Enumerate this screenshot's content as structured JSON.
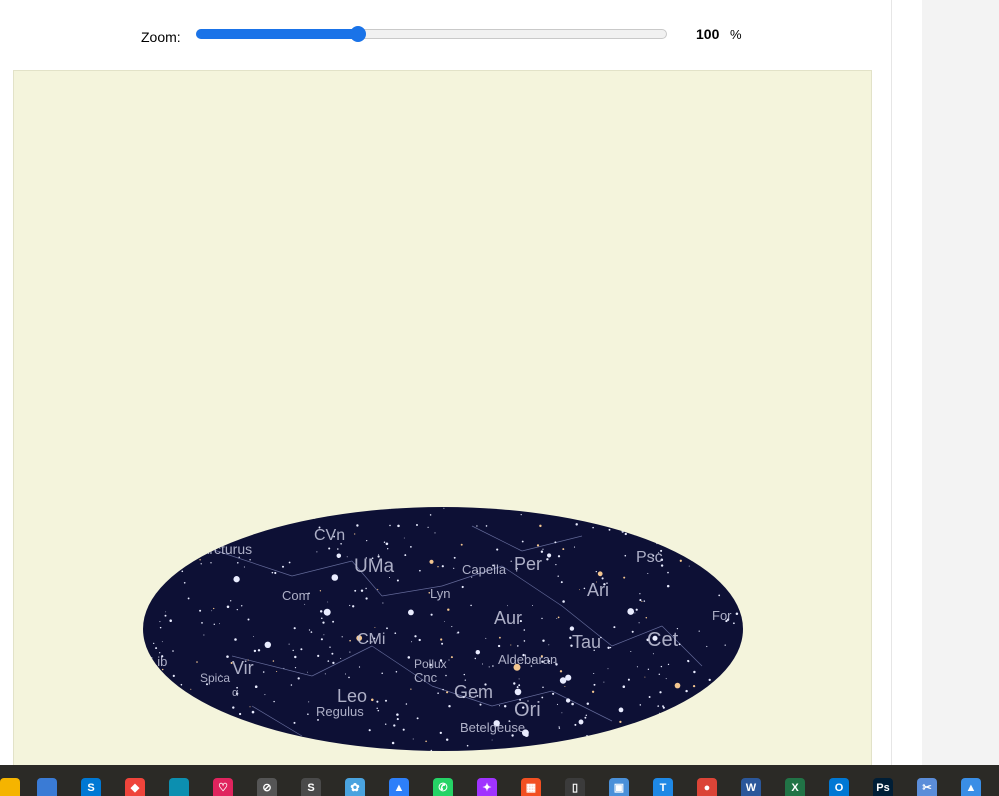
{
  "zoom": {
    "label": "Zoom:",
    "value": "100",
    "unit": "%",
    "slider_fraction": 0.345
  },
  "sky_labels": [
    "Arcturus",
    "CVn",
    "UMa",
    "Capella",
    "Per",
    "Psc",
    "Com",
    "Lyn",
    "Aur",
    "Ari",
    "For",
    "CMi",
    "Tau",
    "Cet",
    "Lib",
    "Vir",
    "Pollux",
    "Cnc",
    "Aldebaran",
    "Spica",
    "Leo",
    "Gem",
    "Regulus",
    "Ori",
    "Betelgeuse",
    "α"
  ],
  "taskbar": {
    "icons": [
      {
        "name": "file-explorer-icon",
        "color": "#f5b400",
        "glyph": ""
      },
      {
        "name": "copilot-icon",
        "color": "#3a7bd5",
        "glyph": ""
      },
      {
        "name": "skype-icon",
        "color": "#0078d4",
        "glyph": "S"
      },
      {
        "name": "anydesk-icon",
        "color": "#ef443b",
        "glyph": "◆"
      },
      {
        "name": "edge-icon",
        "color": "#0c8fb0",
        "glyph": ""
      },
      {
        "name": "heart-app-icon",
        "color": "#e0245e",
        "glyph": "♡"
      },
      {
        "name": "blocked-app-icon",
        "color": "#555555",
        "glyph": "⊘"
      },
      {
        "name": "s-app-icon",
        "color": "#4a4a4a",
        "glyph": "S"
      },
      {
        "name": "paint-icon",
        "color": "#4aa3df",
        "glyph": "✿"
      },
      {
        "name": "photos-icon",
        "color": "#2d7ff9",
        "glyph": "▲"
      },
      {
        "name": "whatsapp-icon",
        "color": "#25d366",
        "glyph": "✆"
      },
      {
        "name": "messenger-icon",
        "color": "#a033ff",
        "glyph": "✦"
      },
      {
        "name": "store-icon",
        "color": "#f25022",
        "glyph": "▦"
      },
      {
        "name": "book-icon",
        "color": "#3b3b3b",
        "glyph": "▯"
      },
      {
        "name": "control-panel-icon",
        "color": "#4a90d9",
        "glyph": "▣"
      },
      {
        "name": "text-tool-icon",
        "color": "#1e88e5",
        "glyph": "T"
      },
      {
        "name": "chrome-icon",
        "color": "#db4437",
        "glyph": "●"
      },
      {
        "name": "word-icon",
        "color": "#2b579a",
        "glyph": "W"
      },
      {
        "name": "excel-icon",
        "color": "#217346",
        "glyph": "X"
      },
      {
        "name": "outlook-icon",
        "color": "#0078d4",
        "glyph": "O"
      },
      {
        "name": "photoshop-icon",
        "color": "#001e36",
        "glyph": "Ps"
      },
      {
        "name": "snipping-icon",
        "color": "#5b8dd9",
        "glyph": "✂"
      },
      {
        "name": "vlc-icon",
        "color": "#3a8ee6",
        "glyph": "▲"
      }
    ]
  }
}
